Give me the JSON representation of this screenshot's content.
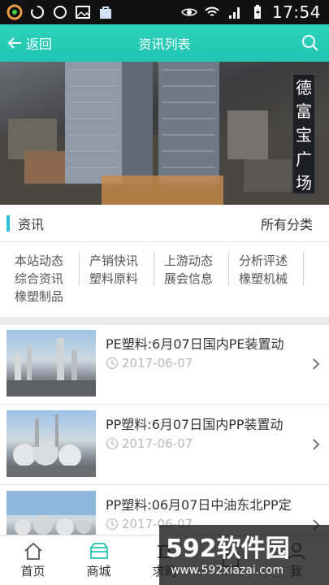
{
  "status_bar": {
    "time": "17:54"
  },
  "header": {
    "back_label": "返回",
    "title": "资讯列表"
  },
  "banner": {
    "sign_chars": [
      "德",
      "富",
      "宝",
      "广",
      "场"
    ]
  },
  "category": {
    "title": "资讯",
    "all_label": "所有分类",
    "rows": [
      [
        "本站动态",
        "产销快讯",
        "上游动态",
        "分析评述"
      ],
      [
        "综合资讯",
        "塑料原料",
        "展会信息",
        "橡塑机械"
      ],
      [
        "橡塑制品"
      ]
    ]
  },
  "news": [
    {
      "title": "PE塑料:6月07日国内PE装置动",
      "date": "2017-06-07"
    },
    {
      "title": "PP塑料:6月07日国内PP装置动",
      "date": "2017-06-07"
    },
    {
      "title": "PP塑料:06月07日中油东北PP定",
      "date": "2017-06-07"
    }
  ],
  "bottom_nav": [
    {
      "label": "首页",
      "icon": "home-icon"
    },
    {
      "label": "商城",
      "icon": "mall-icon"
    },
    {
      "label": "求购",
      "icon": "purchase-icon"
    },
    {
      "label": "",
      "icon": "nav4-icon"
    },
    {
      "label": "我",
      "icon": "me-icon"
    }
  ],
  "watermark": {
    "logo": "592软件园",
    "url": "www.592xiazai.com"
  },
  "colors": {
    "accent": "#21c4b0",
    "category_bar": "#2bbfd8"
  }
}
